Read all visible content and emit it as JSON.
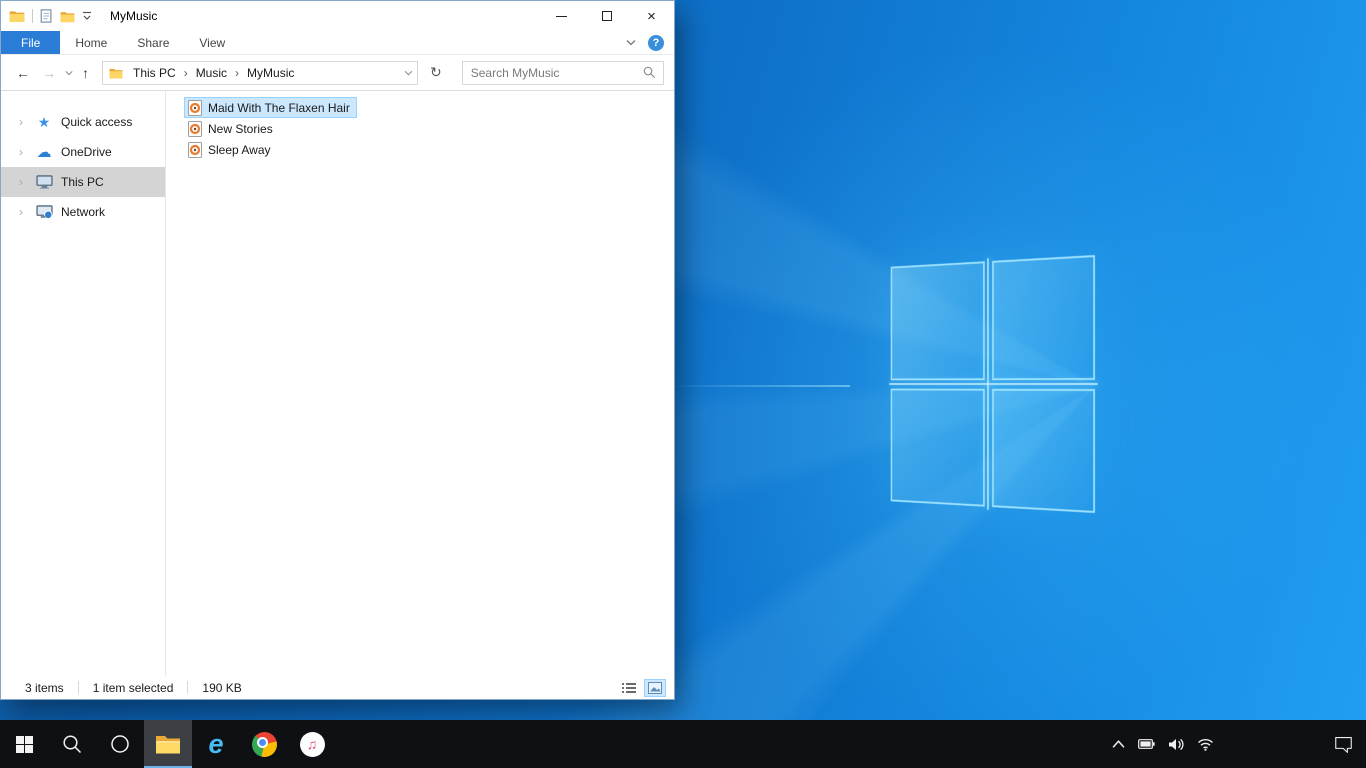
{
  "explorer": {
    "title": "MyMusic",
    "ribbon": {
      "tabs": [
        {
          "label": "File"
        },
        {
          "label": "Home"
        },
        {
          "label": "Share"
        },
        {
          "label": "View"
        }
      ]
    },
    "nav": {
      "breadcrumbs": [
        "This PC",
        "Music",
        "MyMusic"
      ],
      "search_placeholder": "Search MyMusic"
    },
    "sidebar": {
      "items": [
        {
          "label": "Quick access"
        },
        {
          "label": "OneDrive"
        },
        {
          "label": "This PC",
          "selected": true
        },
        {
          "label": "Network"
        }
      ]
    },
    "files": [
      {
        "name": "Maid With The Flaxen Hair",
        "selected": true
      },
      {
        "name": "New Stories"
      },
      {
        "name": "Sleep Away"
      }
    ],
    "statusbar": {
      "count": "3 items",
      "selection": "1 item selected",
      "size": "190 KB"
    }
  },
  "icons": {
    "back": "←",
    "forward": "→",
    "up": "↑",
    "refresh": "↻",
    "breadcrumb_sep": "›",
    "expander": "›",
    "help": "?",
    "close": "×",
    "star": "★",
    "cloud": "☁",
    "ie": "e",
    "note": "♫"
  },
  "colors": {
    "accent": "#0078d7",
    "file_tab_blue": "#2b7cd6",
    "selection_bg": "#cce8ff",
    "selection_border": "#99d1ff",
    "sidebar_selected": "#d4d4d4",
    "taskbar_bg": "#0e1013",
    "desktop_blue": "#0f74cc"
  }
}
